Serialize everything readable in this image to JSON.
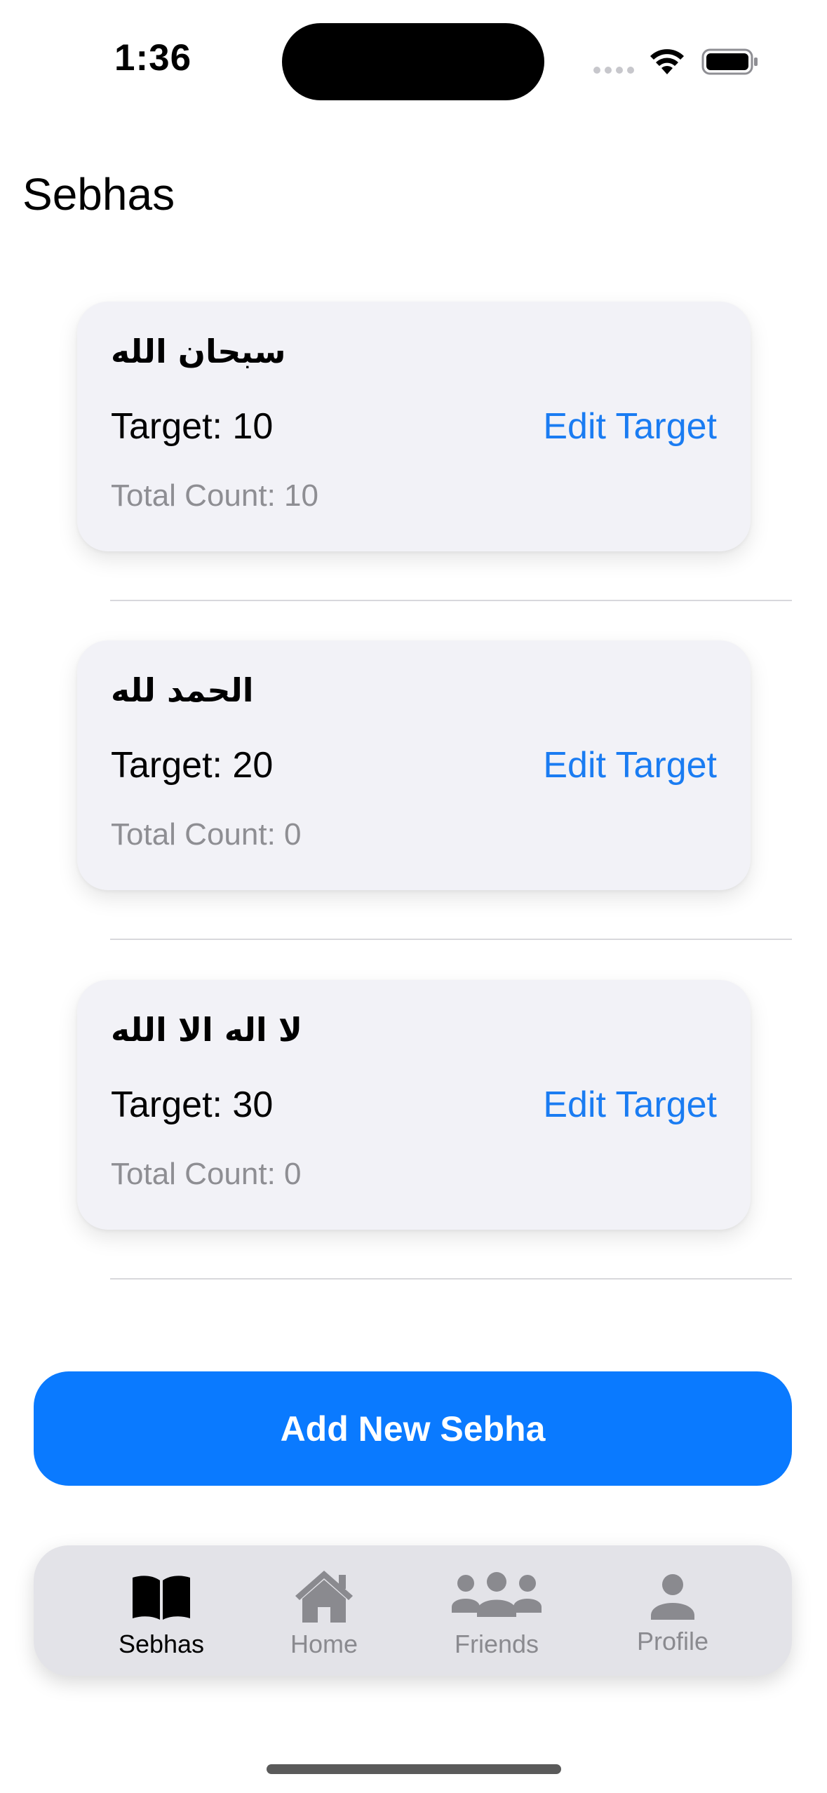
{
  "status_bar": {
    "time": "1:36"
  },
  "page": {
    "title": "Sebhas"
  },
  "sebhas": [
    {
      "name": "سبحان الله",
      "target": "Target: 10",
      "edit_label": "Edit Target",
      "total": "Total Count: 10"
    },
    {
      "name": "الحمد لله",
      "target": "Target: 20",
      "edit_label": "Edit Target",
      "total": "Total Count: 0"
    },
    {
      "name": "لا اله الا الله",
      "target": "Target: 30",
      "edit_label": "Edit Target",
      "total": "Total Count: 0"
    }
  ],
  "add_button": {
    "label": "Add New Sebha"
  },
  "tab_bar": {
    "tabs": [
      {
        "label": "Sebhas",
        "icon": "book-icon",
        "active": true
      },
      {
        "label": "Home",
        "icon": "house-icon",
        "active": false
      },
      {
        "label": "Friends",
        "icon": "people-icon",
        "active": false
      },
      {
        "label": "Profile",
        "icon": "person-icon",
        "active": false
      }
    ]
  },
  "colors": {
    "accent": "#0a7aff",
    "link": "#1a7cf2",
    "card_background": "#f2f2f7",
    "secondary_text": "#8e8e93"
  }
}
